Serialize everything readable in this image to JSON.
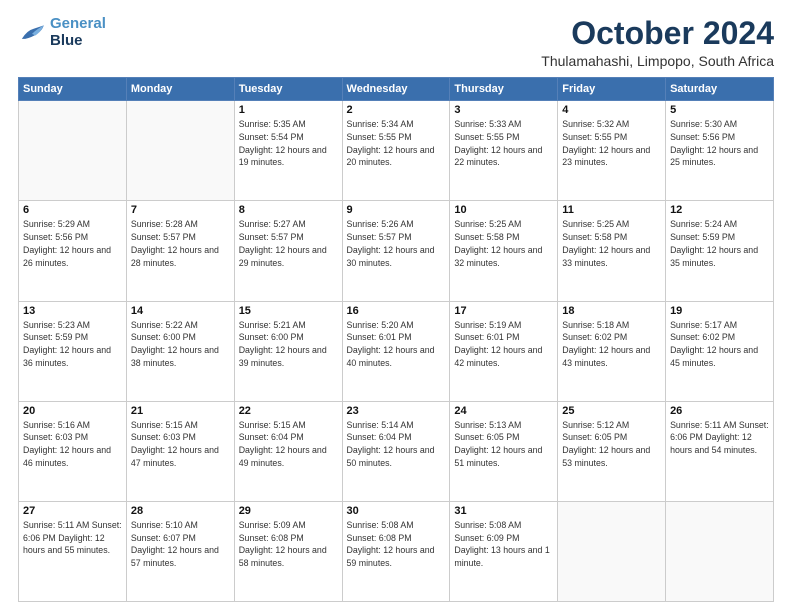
{
  "header": {
    "logo_line1": "General",
    "logo_line2": "Blue",
    "title": "October 2024",
    "subtitle": "Thulamahashi, Limpopo, South Africa"
  },
  "days_of_week": [
    "Sunday",
    "Monday",
    "Tuesday",
    "Wednesday",
    "Thursday",
    "Friday",
    "Saturday"
  ],
  "weeks": [
    [
      {
        "day": "",
        "info": ""
      },
      {
        "day": "",
        "info": ""
      },
      {
        "day": "1",
        "info": "Sunrise: 5:35 AM\nSunset: 5:54 PM\nDaylight: 12 hours\nand 19 minutes."
      },
      {
        "day": "2",
        "info": "Sunrise: 5:34 AM\nSunset: 5:55 PM\nDaylight: 12 hours\nand 20 minutes."
      },
      {
        "day": "3",
        "info": "Sunrise: 5:33 AM\nSunset: 5:55 PM\nDaylight: 12 hours\nand 22 minutes."
      },
      {
        "day": "4",
        "info": "Sunrise: 5:32 AM\nSunset: 5:55 PM\nDaylight: 12 hours\nand 23 minutes."
      },
      {
        "day": "5",
        "info": "Sunrise: 5:30 AM\nSunset: 5:56 PM\nDaylight: 12 hours\nand 25 minutes."
      }
    ],
    [
      {
        "day": "6",
        "info": "Sunrise: 5:29 AM\nSunset: 5:56 PM\nDaylight: 12 hours\nand 26 minutes."
      },
      {
        "day": "7",
        "info": "Sunrise: 5:28 AM\nSunset: 5:57 PM\nDaylight: 12 hours\nand 28 minutes."
      },
      {
        "day": "8",
        "info": "Sunrise: 5:27 AM\nSunset: 5:57 PM\nDaylight: 12 hours\nand 29 minutes."
      },
      {
        "day": "9",
        "info": "Sunrise: 5:26 AM\nSunset: 5:57 PM\nDaylight: 12 hours\nand 30 minutes."
      },
      {
        "day": "10",
        "info": "Sunrise: 5:25 AM\nSunset: 5:58 PM\nDaylight: 12 hours\nand 32 minutes."
      },
      {
        "day": "11",
        "info": "Sunrise: 5:25 AM\nSunset: 5:58 PM\nDaylight: 12 hours\nand 33 minutes."
      },
      {
        "day": "12",
        "info": "Sunrise: 5:24 AM\nSunset: 5:59 PM\nDaylight: 12 hours\nand 35 minutes."
      }
    ],
    [
      {
        "day": "13",
        "info": "Sunrise: 5:23 AM\nSunset: 5:59 PM\nDaylight: 12 hours\nand 36 minutes."
      },
      {
        "day": "14",
        "info": "Sunrise: 5:22 AM\nSunset: 6:00 PM\nDaylight: 12 hours\nand 38 minutes."
      },
      {
        "day": "15",
        "info": "Sunrise: 5:21 AM\nSunset: 6:00 PM\nDaylight: 12 hours\nand 39 minutes."
      },
      {
        "day": "16",
        "info": "Sunrise: 5:20 AM\nSunset: 6:01 PM\nDaylight: 12 hours\nand 40 minutes."
      },
      {
        "day": "17",
        "info": "Sunrise: 5:19 AM\nSunset: 6:01 PM\nDaylight: 12 hours\nand 42 minutes."
      },
      {
        "day": "18",
        "info": "Sunrise: 5:18 AM\nSunset: 6:02 PM\nDaylight: 12 hours\nand 43 minutes."
      },
      {
        "day": "19",
        "info": "Sunrise: 5:17 AM\nSunset: 6:02 PM\nDaylight: 12 hours\nand 45 minutes."
      }
    ],
    [
      {
        "day": "20",
        "info": "Sunrise: 5:16 AM\nSunset: 6:03 PM\nDaylight: 12 hours\nand 46 minutes."
      },
      {
        "day": "21",
        "info": "Sunrise: 5:15 AM\nSunset: 6:03 PM\nDaylight: 12 hours\nand 47 minutes."
      },
      {
        "day": "22",
        "info": "Sunrise: 5:15 AM\nSunset: 6:04 PM\nDaylight: 12 hours\nand 49 minutes."
      },
      {
        "day": "23",
        "info": "Sunrise: 5:14 AM\nSunset: 6:04 PM\nDaylight: 12 hours\nand 50 minutes."
      },
      {
        "day": "24",
        "info": "Sunrise: 5:13 AM\nSunset: 6:05 PM\nDaylight: 12 hours\nand 51 minutes."
      },
      {
        "day": "25",
        "info": "Sunrise: 5:12 AM\nSunset: 6:05 PM\nDaylight: 12 hours\nand 53 minutes."
      },
      {
        "day": "26",
        "info": "Sunrise: 5:11 AM\nSunset: 6:06 PM\nDaylight: 12 hours\nand 54 minutes."
      }
    ],
    [
      {
        "day": "27",
        "info": "Sunrise: 5:11 AM\nSunset: 6:06 PM\nDaylight: 12 hours\nand 55 minutes."
      },
      {
        "day": "28",
        "info": "Sunrise: 5:10 AM\nSunset: 6:07 PM\nDaylight: 12 hours\nand 57 minutes."
      },
      {
        "day": "29",
        "info": "Sunrise: 5:09 AM\nSunset: 6:08 PM\nDaylight: 12 hours\nand 58 minutes."
      },
      {
        "day": "30",
        "info": "Sunrise: 5:08 AM\nSunset: 6:08 PM\nDaylight: 12 hours\nand 59 minutes."
      },
      {
        "day": "31",
        "info": "Sunrise: 5:08 AM\nSunset: 6:09 PM\nDaylight: 13 hours\nand 1 minute."
      },
      {
        "day": "",
        "info": ""
      },
      {
        "day": "",
        "info": ""
      }
    ]
  ]
}
